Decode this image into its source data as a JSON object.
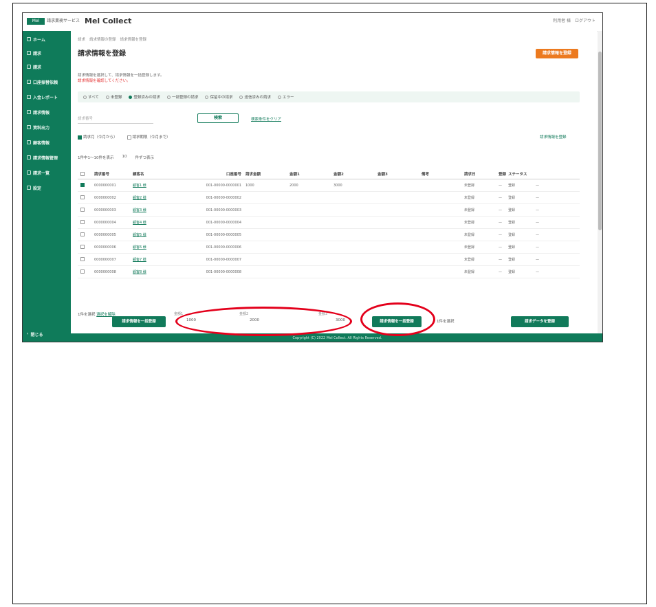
{
  "header": {
    "logo_badge": "Mel",
    "logo_sub": "請求業務サービス",
    "app_title": "Mel Collect",
    "user_name": "利用者 様",
    "logout": "ログアウト"
  },
  "sidebar": {
    "items": [
      {
        "label": "ホーム",
        "top": 0
      },
      {
        "label": "請求",
        "top": 0
      },
      {
        "label": "請求",
        "top": 0
      },
      {
        "label": "口座振替依頼",
        "top": 0
      },
      {
        "label": "入金レポート",
        "top": 0
      },
      {
        "label": "請求情報",
        "top": 0
      },
      {
        "label": "資料出力",
        "top": 0
      },
      {
        "label": "顧客情報",
        "top": 0
      },
      {
        "label": "請求情報管理",
        "top": 0
      },
      {
        "label": "請求一覧",
        "top": 0
      },
      {
        "label": "設定",
        "top": 0
      }
    ],
    "close": "閉じる"
  },
  "main": {
    "breadcrumb": [
      "請求",
      "請求情報の登録",
      "請求情報を登録"
    ],
    "title": "請求情報を登録",
    "orange_button": "請求情報を登録",
    "desc1": "請求情報を選択して、請求情報を一括登録します。",
    "desc2": "請求情報を確認してください。",
    "filters": [
      "すべて",
      "未登録",
      "登録済みの請求",
      "一部登録の請求",
      "保留中の請求",
      "送信済みの請求",
      "エラー"
    ],
    "filter_selected": 2,
    "search_placeholder": "請求番号",
    "search_button": "検索",
    "clear_link": "検索条件をクリア",
    "check1": "請求月（今月から）",
    "check2": "請求期限（今月まで）",
    "right_link": "請求情報を登録",
    "pager_text": "1件中1〜10件を表示",
    "pager_page": "10",
    "pager_unit": "件ずつ表示"
  },
  "table": {
    "headers": [
      "",
      "請求番号",
      "顧客名",
      "",
      "口座番号",
      "請求金額",
      "金額1",
      "金額2",
      "金額3",
      "備考",
      "請求日",
      "登録",
      "",
      "ステータス",
      ""
    ],
    "rows": [
      {
        "checked": true,
        "id": "0000000001",
        "name": "顧客1 様",
        "account": "001-00000-0000001",
        "amt": "1000",
        "v2": "2000",
        "v3": "3000",
        "status": "未登録",
        "state": "登録"
      },
      {
        "checked": false,
        "id": "0000000002",
        "name": "顧客2 様",
        "account": "001-00000-0000002",
        "amt": "",
        "v2": "",
        "v3": "",
        "status": "未登録",
        "state": "登録"
      },
      {
        "checked": false,
        "id": "0000000003",
        "name": "顧客3 様",
        "account": "001-00000-0000003",
        "amt": "",
        "v2": "",
        "v3": "",
        "status": "未登録",
        "state": "登録"
      },
      {
        "checked": false,
        "id": "0000000004",
        "name": "顧客4 様",
        "account": "001-00000-0000004",
        "amt": "",
        "v2": "",
        "v3": "",
        "status": "未登録",
        "state": "登録"
      },
      {
        "checked": false,
        "id": "0000000005",
        "name": "顧客5 様",
        "account": "001-00000-0000005",
        "amt": "",
        "v2": "",
        "v3": "",
        "status": "未登録",
        "state": "登録"
      },
      {
        "checked": false,
        "id": "0000000006",
        "name": "顧客6 様",
        "account": "001-00000-0000006",
        "amt": "",
        "v2": "",
        "v3": "",
        "status": "未登録",
        "state": "登録"
      },
      {
        "checked": false,
        "id": "0000000007",
        "name": "顧客7 様",
        "account": "001-00000-0000007",
        "amt": "",
        "v2": "",
        "v3": "",
        "status": "未登録",
        "state": "登録"
      },
      {
        "checked": false,
        "id": "0000000008",
        "name": "顧客8 様",
        "account": "001-00000-0000008",
        "amt": "",
        "v2": "",
        "v3": "",
        "status": "未登録",
        "state": "登録"
      }
    ]
  },
  "footnote": {
    "text": "1件を選択",
    "link": "選択を解除"
  },
  "bottom": {
    "left_button": "請求情報を一括登録",
    "sums": [
      {
        "label": "金額1",
        "value": "1000"
      },
      {
        "label": "金額2",
        "value": "2000"
      },
      {
        "label": "金額3",
        "value": "3000"
      }
    ],
    "center_button": "請求情報を一括登録",
    "mid_text": "1件を選択",
    "right_button": "請求データを登録"
  },
  "footer": {
    "copyright": "Copyright (C) 2022 Mel Collect. All Rights Reserved."
  },
  "colors": {
    "brand_green": "#117a5a",
    "accent_orange": "#ec7a1f",
    "annotation_red": "#e3001b"
  }
}
